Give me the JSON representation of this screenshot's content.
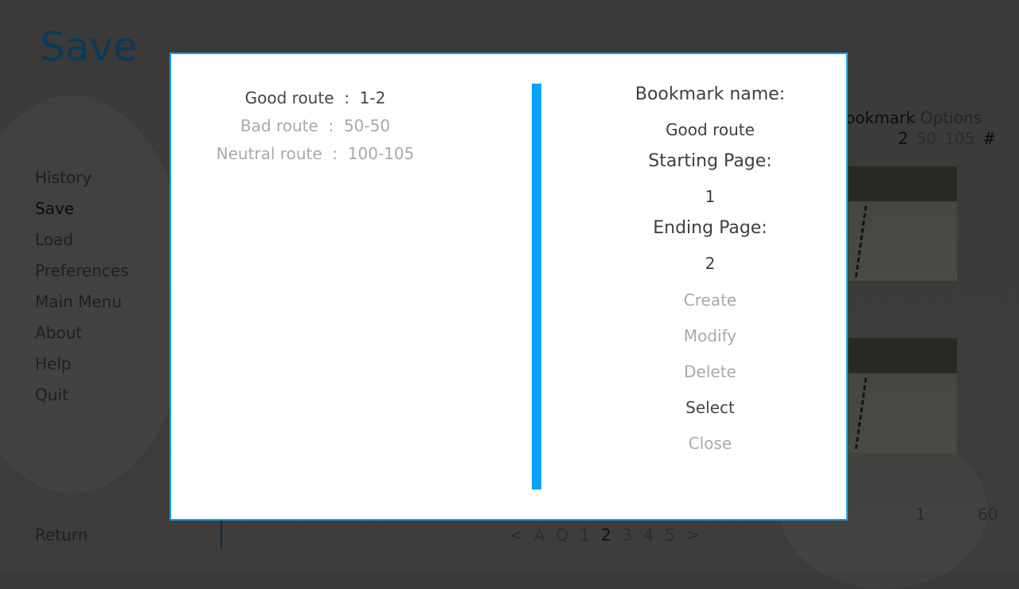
{
  "screen": {
    "title": "Save",
    "nav": [
      "History",
      "Save",
      "Load",
      "Preferences",
      "Main Menu",
      "About",
      "Help",
      "Quit"
    ],
    "active_nav": "Save",
    "return_label": "Return",
    "bookmark_header": {
      "bookmark": "ookmark",
      "options": "Options"
    },
    "bookmark_pages": [
      "2",
      "50",
      "105",
      "#"
    ],
    "slot_range": {
      "start": "1",
      "end": "60"
    },
    "pager": [
      "<",
      "A",
      "Q",
      "1",
      "2",
      "3",
      "4",
      "5",
      ">"
    ],
    "pager_current": "2"
  },
  "dialog": {
    "routes": [
      {
        "text": "Good route  :  1-2",
        "selected": true
      },
      {
        "text": "Bad route  :  50-50",
        "selected": false
      },
      {
        "text": "Neutral route  :  100-105",
        "selected": false
      }
    ],
    "bookmark_name_label": "Bookmark name:",
    "bookmark_name_value": "Good route",
    "starting_page_label": "Starting Page:",
    "starting_page_value": "1",
    "ending_page_label": "Ending Page:",
    "ending_page_value": "2",
    "buttons": {
      "create": "Create",
      "modify": "Modify",
      "delete": "Delete",
      "select": "Select",
      "close": "Close"
    },
    "accent_color": "#0aa0ff"
  }
}
